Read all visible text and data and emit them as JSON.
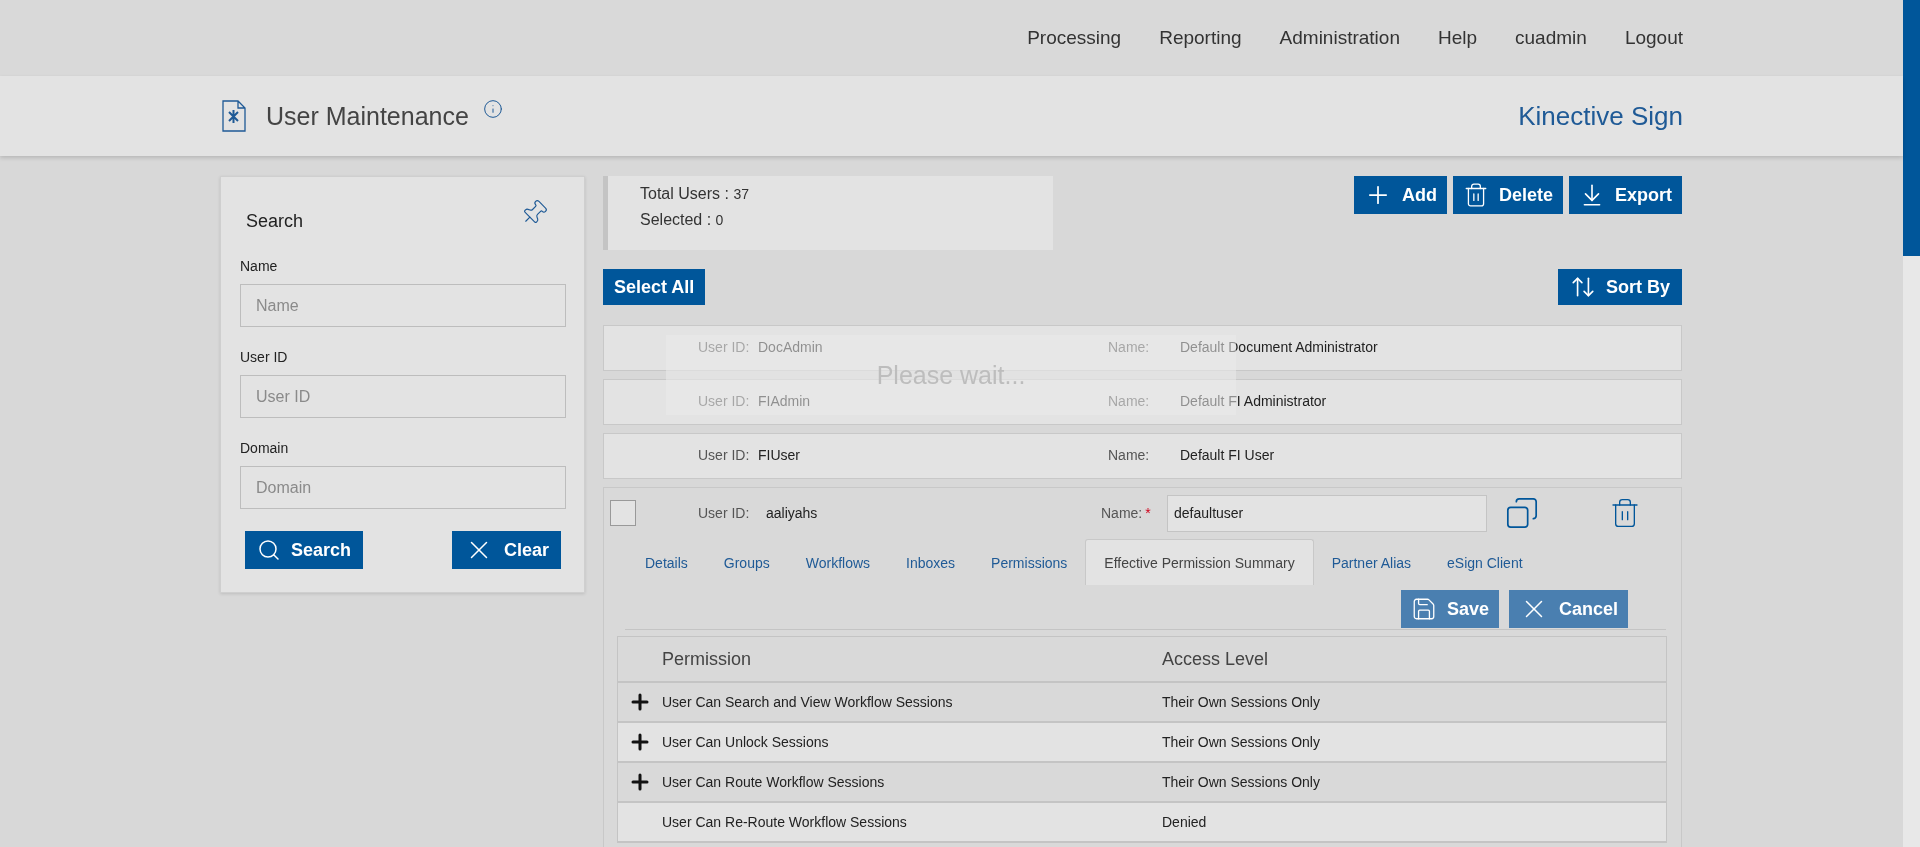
{
  "nav": [
    "Processing",
    "Reporting",
    "Administration",
    "Help",
    "cuadmin",
    "Logout"
  ],
  "header": {
    "title": "User Maintenance",
    "brand": "Kinective Sign"
  },
  "search_panel": {
    "title": "Search",
    "fields": [
      {
        "label": "Name",
        "placeholder": "Name"
      },
      {
        "label": "User ID",
        "placeholder": "User ID"
      },
      {
        "label": "Domain",
        "placeholder": "Domain"
      }
    ],
    "buttons": [
      {
        "kind": "search",
        "label": "Search"
      },
      {
        "kind": "clear",
        "label": "Clear"
      }
    ]
  },
  "summary": [
    {
      "label": "Total Users :",
      "value": "37"
    },
    {
      "label": "Selected :",
      "value": "0"
    }
  ],
  "toolbar": [
    {
      "kind": "add",
      "label": "Add"
    },
    {
      "kind": "delete",
      "label": "Delete"
    },
    {
      "kind": "export",
      "label": "Export"
    }
  ],
  "select_all": "Select All",
  "sort_by": "Sort By",
  "users": [
    {
      "user_id_label": "User ID:",
      "user_id": "DocAdmin",
      "name_label": "Name:",
      "name": "Default Document Administrator"
    },
    {
      "user_id_label": "User ID:",
      "user_id": "FIAdmin",
      "name_label": "Name:",
      "name": "Default FI Administrator"
    },
    {
      "user_id_label": "User ID:",
      "user_id": "FIUser",
      "name_label": "Name:",
      "name": "Default FI User"
    }
  ],
  "loading": "Please wait...",
  "editor": {
    "checked": false,
    "user_id_label": "User ID:",
    "user_id": "aaliyahs",
    "name_label": "Name:",
    "required_mark": "*",
    "name": "defaultuser",
    "tabs": [
      {
        "label": "Details",
        "selected": false
      },
      {
        "label": "Groups",
        "selected": false
      },
      {
        "label": "Workflows",
        "selected": false
      },
      {
        "label": "Inboxes",
        "selected": false
      },
      {
        "label": "Permissions",
        "selected": false
      },
      {
        "label": "Effective Permission Summary",
        "selected": true
      },
      {
        "label": "Partner Alias",
        "selected": false
      },
      {
        "label": "eSign Client",
        "selected": false
      }
    ],
    "actions": [
      {
        "kind": "save",
        "label": "Save"
      },
      {
        "kind": "cancel",
        "label": "Cancel"
      }
    ],
    "table": {
      "columns": [
        "Permission",
        "Access Level"
      ],
      "rows": [
        {
          "expandable": true,
          "permission": "User Can Search and View Workflow Sessions",
          "access": "Their Own Sessions Only"
        },
        {
          "expandable": true,
          "permission": "User Can Unlock Sessions",
          "access": "Their Own Sessions Only"
        },
        {
          "expandable": true,
          "permission": "User Can Route Workflow Sessions",
          "access": "Their Own Sessions Only"
        },
        {
          "expandable": false,
          "permission": "User Can Re-Route Workflow Sessions",
          "access": "Denied"
        }
      ]
    }
  }
}
